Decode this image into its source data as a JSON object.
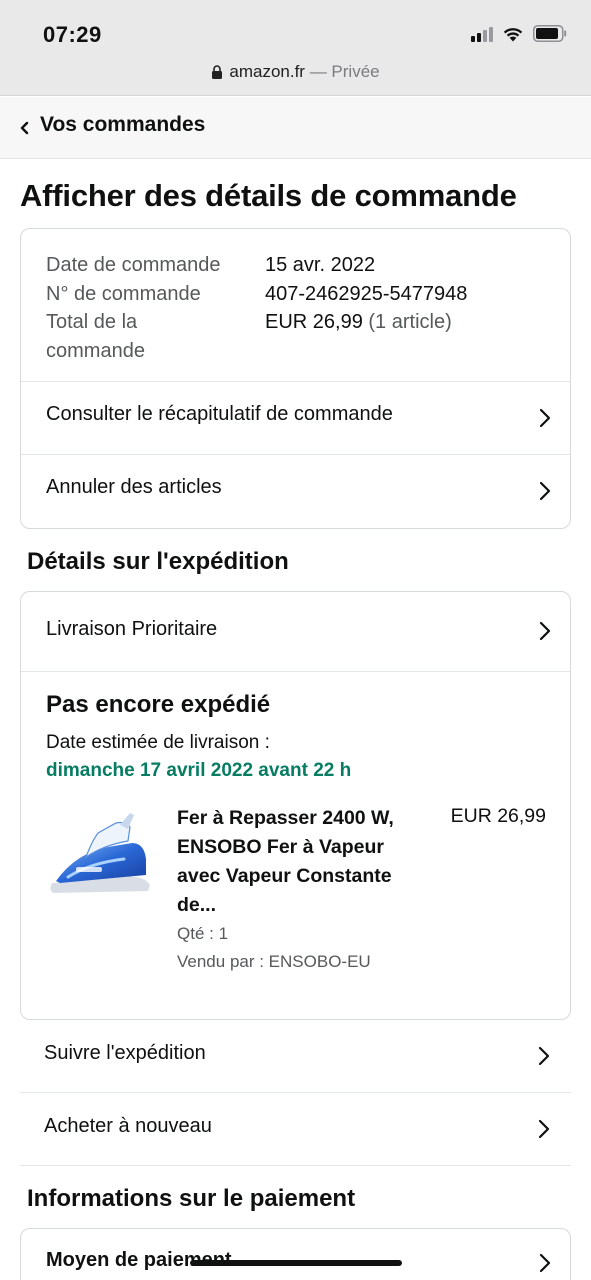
{
  "status_bar": {
    "time": "07:29",
    "signal_icon": "cellular-signal-icon",
    "wifi_icon": "wifi-icon",
    "battery_icon": "battery-icon"
  },
  "url_bar": {
    "domain": "amazon.fr",
    "mode": " — Privée",
    "lock_icon": "lock-icon"
  },
  "nav": {
    "back_label": "Vos commandes",
    "back_icon": "chevron-left-icon"
  },
  "page_title": "Afficher des détails de commande",
  "order_summary": {
    "date_label": "Date de commande",
    "date_value": "15 avr. 2022",
    "number_label": "N° de commande",
    "number_value": "407-2462925-5477948",
    "total_label_1": "Total de la",
    "total_label_2": "commande",
    "total_value": "EUR 26,99",
    "total_items": " (1 article)"
  },
  "order_actions": [
    {
      "label": "Consulter le récapitulatif de commande"
    },
    {
      "label": "Annuler des articles"
    }
  ],
  "shipping": {
    "section_title": "Détails sur l'expédition",
    "method": "Livraison Prioritaire",
    "status": "Pas encore expédié",
    "eta_label": "Date estimée de livraison :",
    "eta_date": "dimanche 17 avril 2022 avant 22 h",
    "eta_color": "#067d62",
    "product": {
      "title_line1": "Fer à Repasser 2400 W,",
      "title_line2": "ENSOBO Fer à Vapeur",
      "title_line3": "avec Vapeur Constante",
      "title_line4": "de...",
      "price": "EUR 26,99",
      "qty": "Qté : 1",
      "seller": "Vendu par : ENSOBO-EU",
      "image_icon": "steam-iron-product-image"
    },
    "actions": [
      {
        "label": "Suivre l'expédition"
      },
      {
        "label": "Acheter à nouveau"
      }
    ]
  },
  "payment": {
    "section_title": "Informations sur le paiement",
    "method_label": "Moyen de paiement"
  },
  "colors": {
    "accent_green": "#067d62",
    "border": "#d5d9d9",
    "muted_text": "#565959"
  }
}
